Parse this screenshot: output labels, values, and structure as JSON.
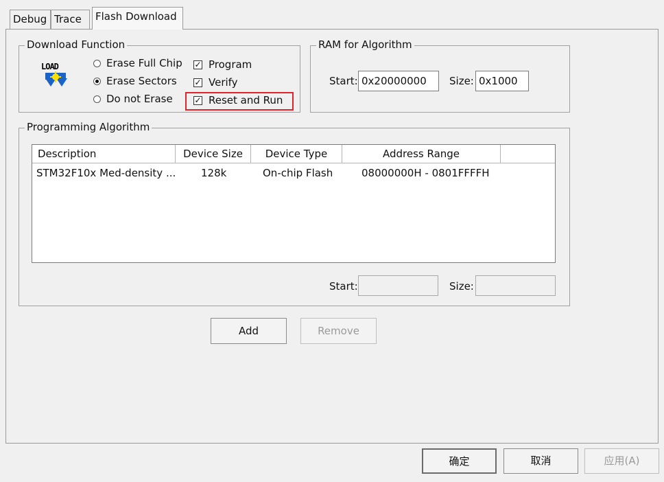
{
  "tabs": [
    "Debug",
    "Trace",
    "Flash Download"
  ],
  "download_function": {
    "title": "Download Function",
    "icon_text": "LOAD",
    "radios": [
      {
        "label": "Erase Full Chip",
        "selected": false
      },
      {
        "label": "Erase Sectors",
        "selected": true
      },
      {
        "label": "Do not Erase",
        "selected": false
      }
    ],
    "checks": [
      {
        "label": "Program",
        "checked": true
      },
      {
        "label": "Verify",
        "checked": true
      },
      {
        "label": "Reset and Run",
        "checked": true,
        "highlighted": true
      }
    ],
    "highlight_color": "#e0242b"
  },
  "ram": {
    "title": "RAM for Algorithm",
    "start_label": "Start:",
    "start_value": "0x20000000",
    "size_label": "Size:",
    "size_value": "0x1000"
  },
  "algorithm": {
    "title": "Programming Algorithm",
    "columns": [
      "Description",
      "Device Size",
      "Device Type",
      "Address Range"
    ],
    "rows": [
      [
        "STM32F10x Med-density ...",
        "128k",
        "On-chip Flash",
        "08000000H - 0801FFFFH"
      ]
    ],
    "start_label": "Start:",
    "start_value": "",
    "size_label": "Size:",
    "size_value": ""
  },
  "buttons": {
    "add": "Add",
    "remove": "Remove",
    "ok": "确定",
    "cancel": "取消",
    "apply": "应用(A)"
  }
}
